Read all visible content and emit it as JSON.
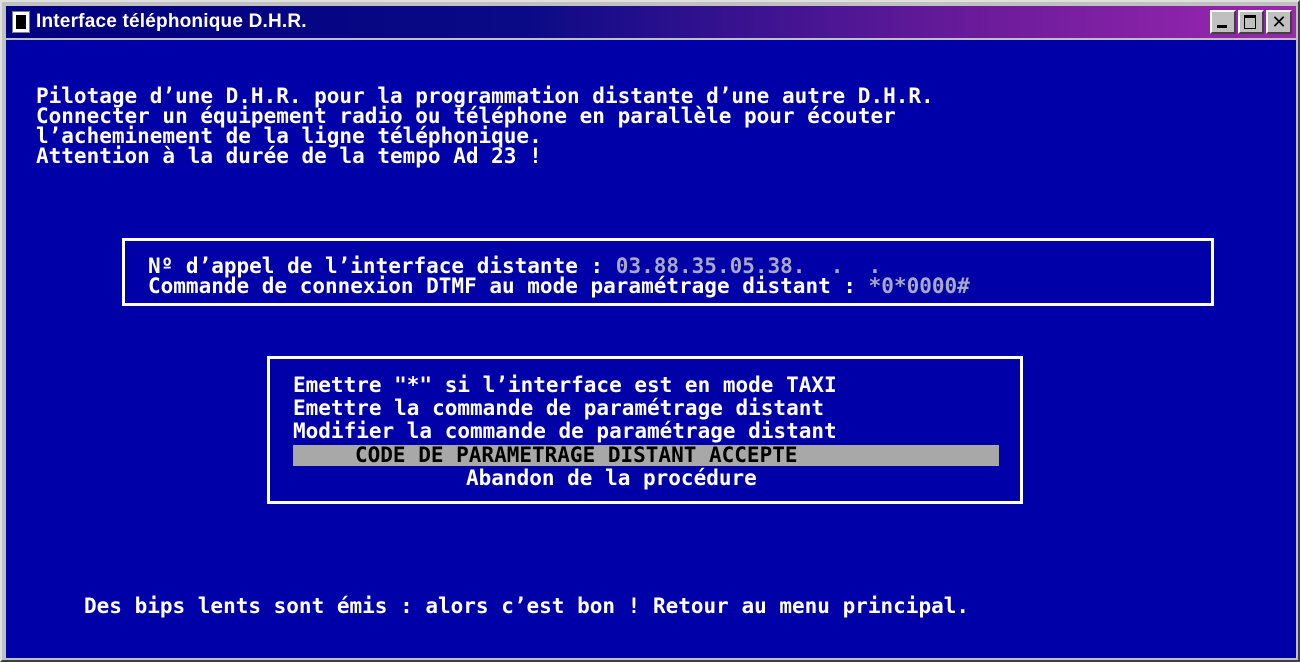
{
  "window": {
    "title": "Interface téléphonique D.H.R.",
    "buttons": [
      "minimize",
      "maximize",
      "close"
    ]
  },
  "intro": [
    "Pilotage d’une D.H.R. pour la programmation distante d’une autre D.H.R.",
    "Connecter un équipement radio ou téléphone en parallèle pour écouter",
    "l’acheminement de la ligne téléphonique.",
    "Attention à la durée de la tempo Ad 23 !"
  ],
  "call_box": {
    "phone_label": "Nº d’appel de l’interface distante : ",
    "phone_value": "03.88.35.05.38.  .  .",
    "dtmf_label": "Commande de connexion DTMF au mode paramétrage distant : ",
    "dtmf_value": "*0*0000#"
  },
  "menu": {
    "items": [
      "Emettre \"*\" si l’interface est en mode TAXI",
      "Emettre la commande de paramétrage distant",
      "Modifier la commande de paramétrage distant",
      "CODE DE PARAMETRAGE DISTANT ACCEPTE",
      "Abandon de la procédure"
    ],
    "selected_index": 3
  },
  "footer": "Des bips lents sont émis : alors c’est bon ! Retour au menu principal.",
  "colors": {
    "console_bg": "#0000a8",
    "text": "#ffffff",
    "dim_text": "#a8a8c8",
    "highlight_bg": "#a8a8a8",
    "titlebar_start": "#000080",
    "titlebar_end": "#9c27b0"
  }
}
